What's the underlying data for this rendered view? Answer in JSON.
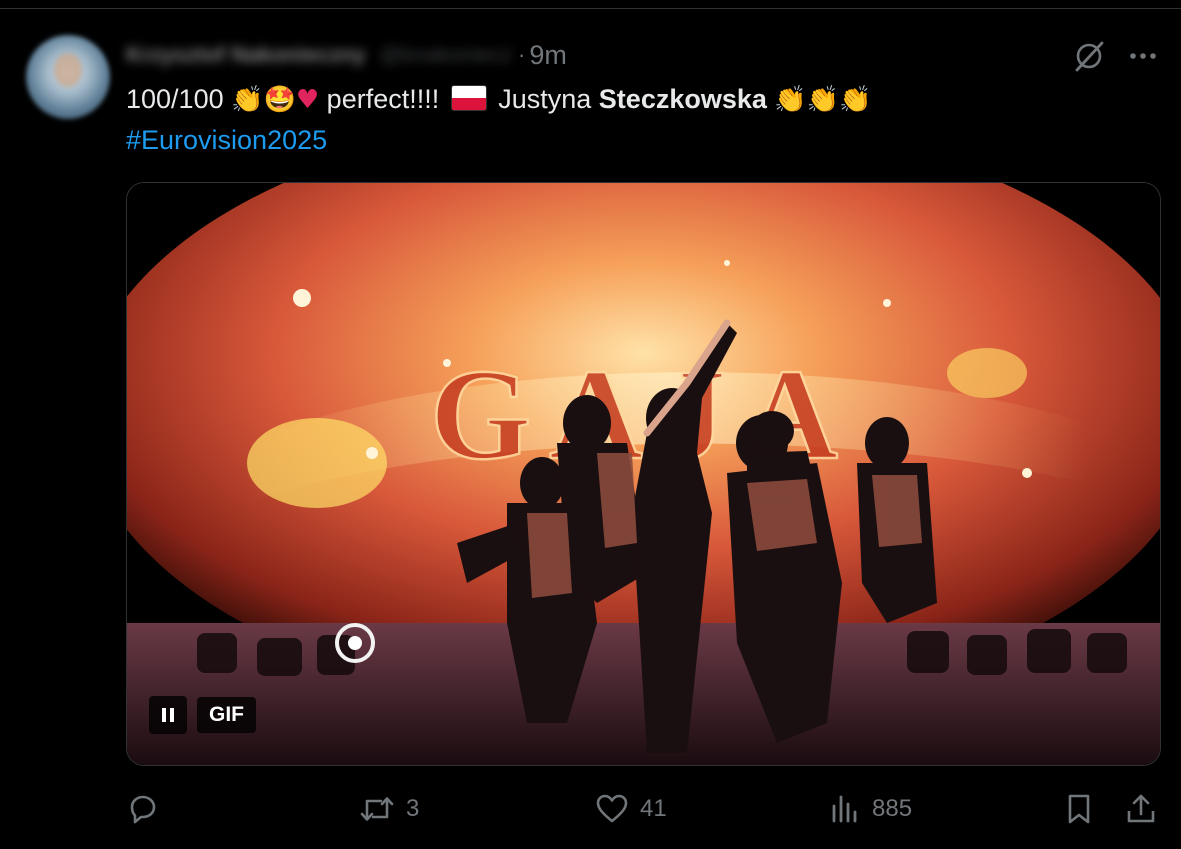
{
  "tweet": {
    "time": "9m",
    "text": {
      "part1": "100/100 ",
      "part2": " perfect!!!! ",
      "part3": " Justyna ",
      "surname": "Steczkowska",
      "hashtag": "#Eurovision2025"
    },
    "emoji": {
      "clap": "👏",
      "star_struck": "🤩",
      "heart": "♥",
      "clap_triple": "👏👏👏"
    },
    "media": {
      "type": "gif",
      "scene_text": "GAJA",
      "badge_label": "GIF"
    },
    "stats": {
      "replies": "",
      "reposts": "3",
      "likes": "41",
      "views": "885"
    }
  },
  "icons": {
    "grok": "grok-icon",
    "more": "more-icon",
    "pause": "pause-icon",
    "reply": "reply-icon",
    "repost": "repost-icon",
    "like": "heart-icon",
    "views": "views-icon",
    "bookmark": "bookmark-icon",
    "share": "share-icon"
  },
  "colors": {
    "background": "#000000",
    "text": "#e7e9ea",
    "muted": "#71767b",
    "link": "#1d9bf0",
    "heart_emoji": "#e0245e"
  }
}
